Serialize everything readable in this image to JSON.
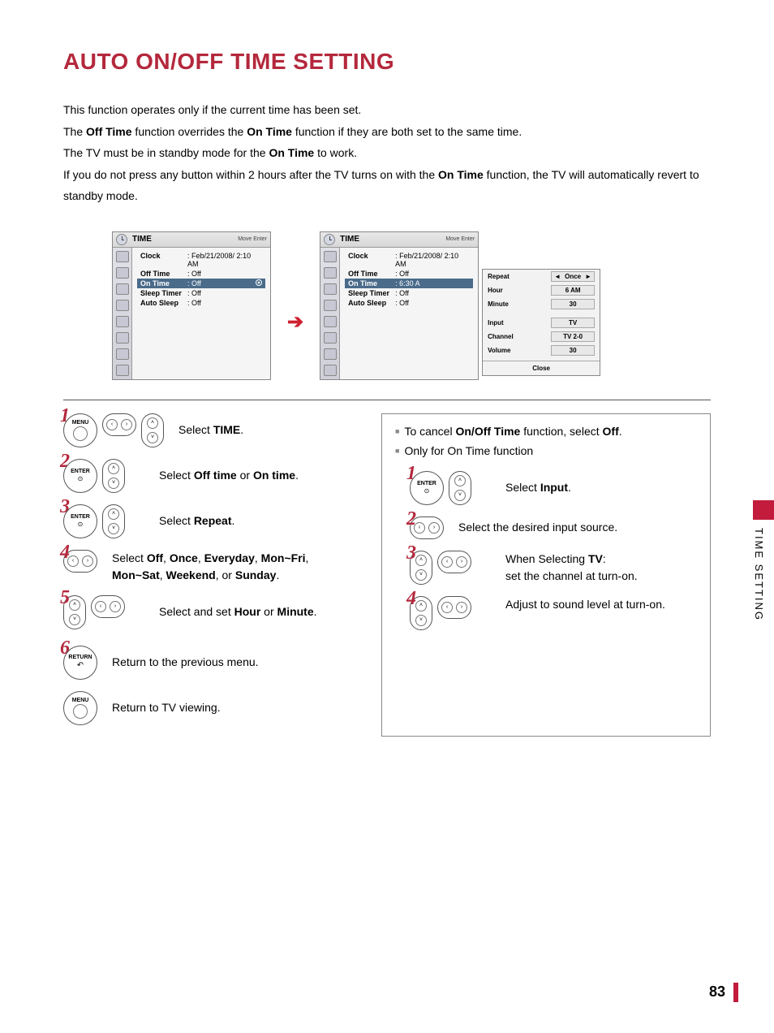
{
  "title": "AUTO ON/OFF TIME SETTING",
  "intro": {
    "l1": "This function operates only if the current time has been set.",
    "l2a": "The ",
    "l2b": "Off Time",
    "l2c": " function overrides the ",
    "l2d": "On Time",
    "l2e": " function if they are both set to the same time.",
    "l3a": "The TV must be in standby mode for the ",
    "l3b": "On Time",
    "l3c": " to work.",
    "l4a": "If you do not press any button within 2 hours after the TV turns on with the ",
    "l4b": "On Time",
    "l4c": " function, the TV will automatically revert to standby mode."
  },
  "osd": {
    "title": "TIME",
    "hints": "Move    Enter",
    "rows": {
      "clock_l": "Clock",
      "clock_v": "Feb/21/2008/ 2:10 AM",
      "off_l": "Off Time",
      "off_v": "Off",
      "on_l": "On Time",
      "on_v1": "Off",
      "on_v2": "6:30 A",
      "sleep_l": "Sleep Timer",
      "sleep_v": "Off",
      "auto_l": "Auto Sleep",
      "auto_v": "Off"
    },
    "popup": {
      "repeat_l": "Repeat",
      "repeat_v": "Once",
      "hour_l": "Hour",
      "hour_v": "6 AM",
      "minute_l": "Minute",
      "minute_v": "30",
      "input_l": "Input",
      "input_v": "TV",
      "channel_l": "Channel",
      "channel_v": "TV 2-0",
      "volume_l": "Volume",
      "volume_v": "30",
      "close": "Close"
    }
  },
  "left_steps": {
    "menu": "MENU",
    "enter": "ENTER",
    "return": "RETURN",
    "s1a": "Select ",
    "s1b": "TIME",
    "s1c": ".",
    "s2a": "Select ",
    "s2b": "Off time",
    "s2c": " or ",
    "s2d": "On time",
    "s2e": ".",
    "s3a": "Select ",
    "s3b": "Repeat",
    "s3c": ".",
    "s4a": "Select ",
    "s4b": "Off",
    "s4c": ", ",
    "s4d": "Once",
    "s4e": ", ",
    "s4f": "Everyday",
    "s4g": ", ",
    "s4h": "Mon~Fri",
    "s4i": ", ",
    "s4j": "Mon~Sat",
    "s4k": ", ",
    "s4l": "Weekend",
    "s4m": ", or ",
    "s4n": "Sunday",
    "s4o": ".",
    "s5a": "Select and set ",
    "s5b": "Hour",
    "s5c": " or ",
    "s5d": "Minute",
    "s5e": ".",
    "s6": "Return to the previous menu.",
    "s7": "Return to TV viewing."
  },
  "right": {
    "b1a": "To cancel ",
    "b1b": "On/Off Time",
    "b1c": " function, select ",
    "b1d": "Off",
    "b1e": ".",
    "b2": "Only for On Time function",
    "s1a": "Select ",
    "s1b": "Input",
    "s1c": ".",
    "s2": "Select the desired input source.",
    "s3a": "When Selecting ",
    "s3b": "TV",
    "s3c": ":",
    "s3d": "set the channel at turn-on.",
    "s4": "Adjust to sound level at turn-on."
  },
  "side_tab": "TIME SETTING",
  "page_num": "83",
  "arrows": {
    "lt": "◄",
    "rt": "►",
    "up": "˄",
    "dn": "˅",
    "l": "‹",
    "r": "›"
  }
}
